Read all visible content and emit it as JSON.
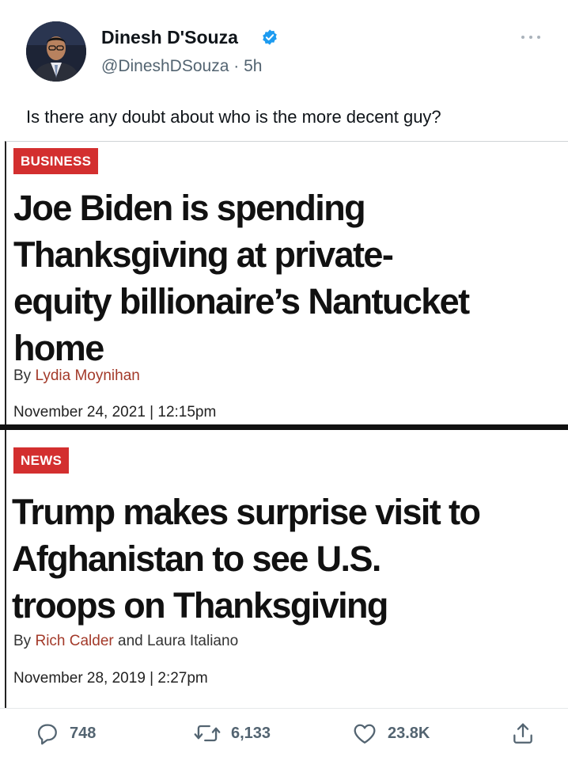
{
  "tweet": {
    "display_name": "Dinesh D'Souza",
    "handle": "@DineshDSouza",
    "time": "5h",
    "text": "Is there any doubt about who is the more decent guy?"
  },
  "articles": [
    {
      "tag": "BUSINESS",
      "headline_lines": [
        "Joe Biden is spending",
        "Thanksgiving at private-",
        "equity billionaire’s Nantucket",
        "home"
      ],
      "by": "By",
      "author": "Lydia Moynihan",
      "date": "November 24, 2021 | 12:15pm"
    },
    {
      "tag": "NEWS",
      "headline_lines": [
        "Trump makes surprise visit to",
        "Afghanistan to see U.S.",
        "troops on Thanksgiving"
      ],
      "by": "By",
      "author": "Rich Calder",
      "coauthor_text": "and Laura Italiano",
      "date": "November 28, 2019 | 2:27pm"
    }
  ],
  "actions": {
    "replies": "748",
    "retweets": "6,133",
    "likes": "23.8K"
  },
  "colors": {
    "verified": "#1d9bf0",
    "tag_bg": "#d32f2f",
    "author_link": "#a33a2a",
    "muted": "#536471"
  },
  "icons": [
    "verified-badge-icon",
    "more-icon",
    "reply-icon",
    "retweet-icon",
    "like-icon",
    "share-icon"
  ]
}
